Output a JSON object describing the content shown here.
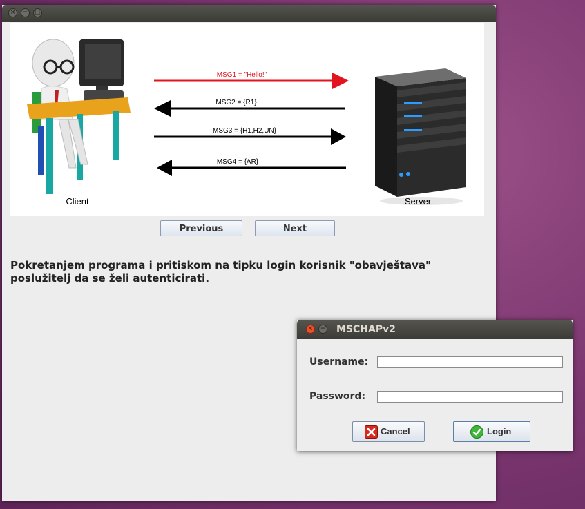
{
  "main_window": {
    "diagram": {
      "client_label": "Client",
      "server_label": "Server",
      "messages": [
        {
          "label": "MSG1 = \"Hello!\"",
          "direction": "right",
          "color": "#e0151f"
        },
        {
          "label": "MSG2 = {R1}",
          "direction": "left",
          "color": "#000000"
        },
        {
          "label": "MSG3 = {H1,H2,UN}",
          "direction": "right",
          "color": "#000000"
        },
        {
          "label": "MSG4 = {AR}",
          "direction": "left",
          "color": "#000000"
        }
      ]
    },
    "nav": {
      "previous_label": "Previous",
      "next_label": "Next"
    },
    "description": "Pokretanjem programa i pritiskom na tipku login korisnik \"obavještava\" poslužitelj da se želi autenticirati."
  },
  "dialog": {
    "title": "MSCHAPv2",
    "username_label": "Username:",
    "username_value": "",
    "password_label": "Password:",
    "password_value": "",
    "cancel_label": "Cancel",
    "login_label": "Login",
    "cancel_icon": "cancel-x-icon",
    "login_icon": "check-icon"
  },
  "colors": {
    "accent_red": "#e0151f",
    "title_bar": "#3c3b37"
  }
}
